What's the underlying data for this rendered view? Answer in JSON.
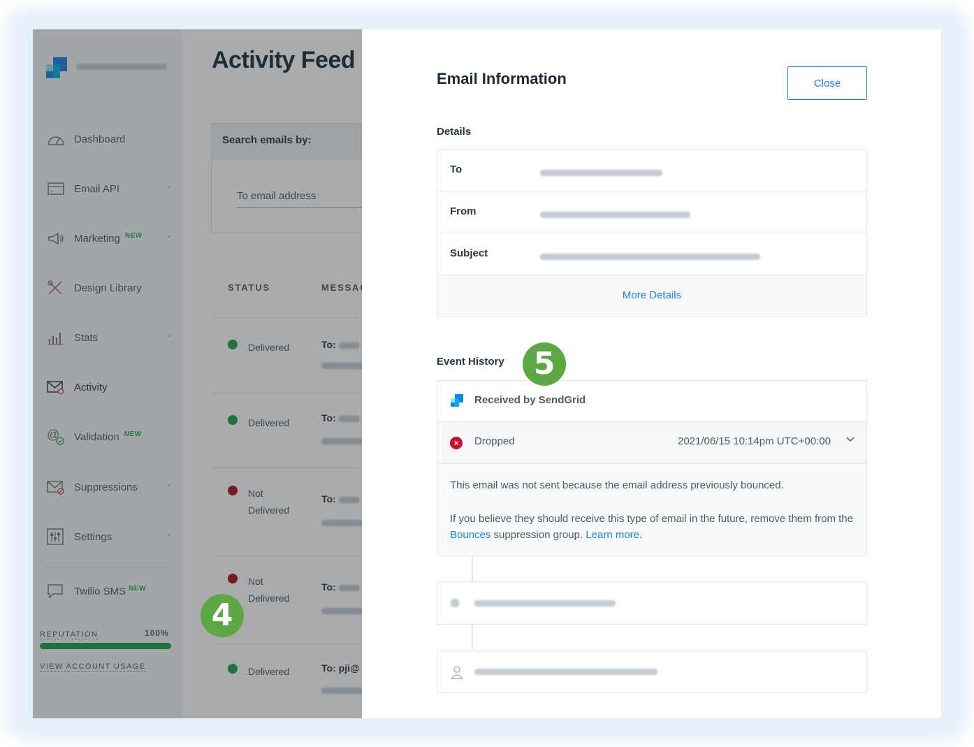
{
  "sidebar": {
    "items": [
      {
        "label": "Dashboard",
        "icon": "dashboard-icon",
        "new": "",
        "chevron": false
      },
      {
        "label": "Email API",
        "icon": "email-api-icon",
        "new": "",
        "chevron": true
      },
      {
        "label": "Marketing",
        "icon": "megaphone-icon",
        "new": "NEW",
        "chevron": true
      },
      {
        "label": "Design Library",
        "icon": "design-library-icon",
        "new": "",
        "chevron": false
      },
      {
        "label": "Stats",
        "icon": "stats-icon",
        "new": "",
        "chevron": true
      },
      {
        "label": "Activity",
        "icon": "activity-icon",
        "new": "",
        "chevron": false
      },
      {
        "label": "Validation",
        "icon": "validation-icon",
        "new": "NEW",
        "chevron": false
      },
      {
        "label": "Suppressions",
        "icon": "suppressions-icon",
        "new": "",
        "chevron": true
      },
      {
        "label": "Settings",
        "icon": "settings-icon",
        "new": "",
        "chevron": true
      },
      {
        "label": "Twilio SMS",
        "icon": "sms-icon",
        "new": "NEW",
        "chevron": false
      }
    ],
    "reputation_label": "REPUTATION",
    "reputation_value": "100%",
    "reputation_fraction": 1.0,
    "usage_link": "VIEW ACCOUNT USAGE"
  },
  "main": {
    "title": "Activity Feed",
    "search_label": "Search emails by:",
    "search_field": "To email address",
    "col_status": "STATUS",
    "col_message": "MESSAG",
    "rows": [
      {
        "status_l1": "Delivered",
        "status_l2": "",
        "to": "To:",
        "color": "#1a9e48"
      },
      {
        "status_l1": "Delivered",
        "status_l2": "",
        "to": "To:",
        "color": "#1a9e48"
      },
      {
        "status_l1": "Not",
        "status_l2": "Delivered",
        "to": "To:",
        "color": "#a3121a"
      },
      {
        "status_l1": "Not",
        "status_l2": "Delivered",
        "to": "To:",
        "color": "#a3121a"
      },
      {
        "status_l1": "Delivered",
        "status_l2": "",
        "to": "To: pji@",
        "color": "#1a9e48"
      }
    ]
  },
  "modal": {
    "title": "Email Information",
    "close_label": "Close",
    "details_label": "Details",
    "details": [
      {
        "key": "To"
      },
      {
        "key": "From"
      },
      {
        "key": "Subject"
      }
    ],
    "more_details": "More Details",
    "event_history_label": "Event History",
    "received_label": "Received by SendGrid",
    "dropped_label": "Dropped",
    "dropped_time": "2021/06/15 10:14pm UTC+00:00",
    "desc_line1": "This email was not sent because the email address previously bounced.",
    "desc_line2_a": "If you believe they should receive this type of email in the future, remove them from the ",
    "desc_link_bounces": "Bounces",
    "desc_line2_b": " suppression group. ",
    "desc_link_learn": "Learn more",
    "desc_line2_c": "."
  },
  "badges": {
    "step4": "4",
    "step5": "5"
  },
  "colors": {
    "accent": "#1a82e2",
    "delivered": "#1a9e48",
    "not_delivered": "#a3121a",
    "badge": "#5da845"
  }
}
